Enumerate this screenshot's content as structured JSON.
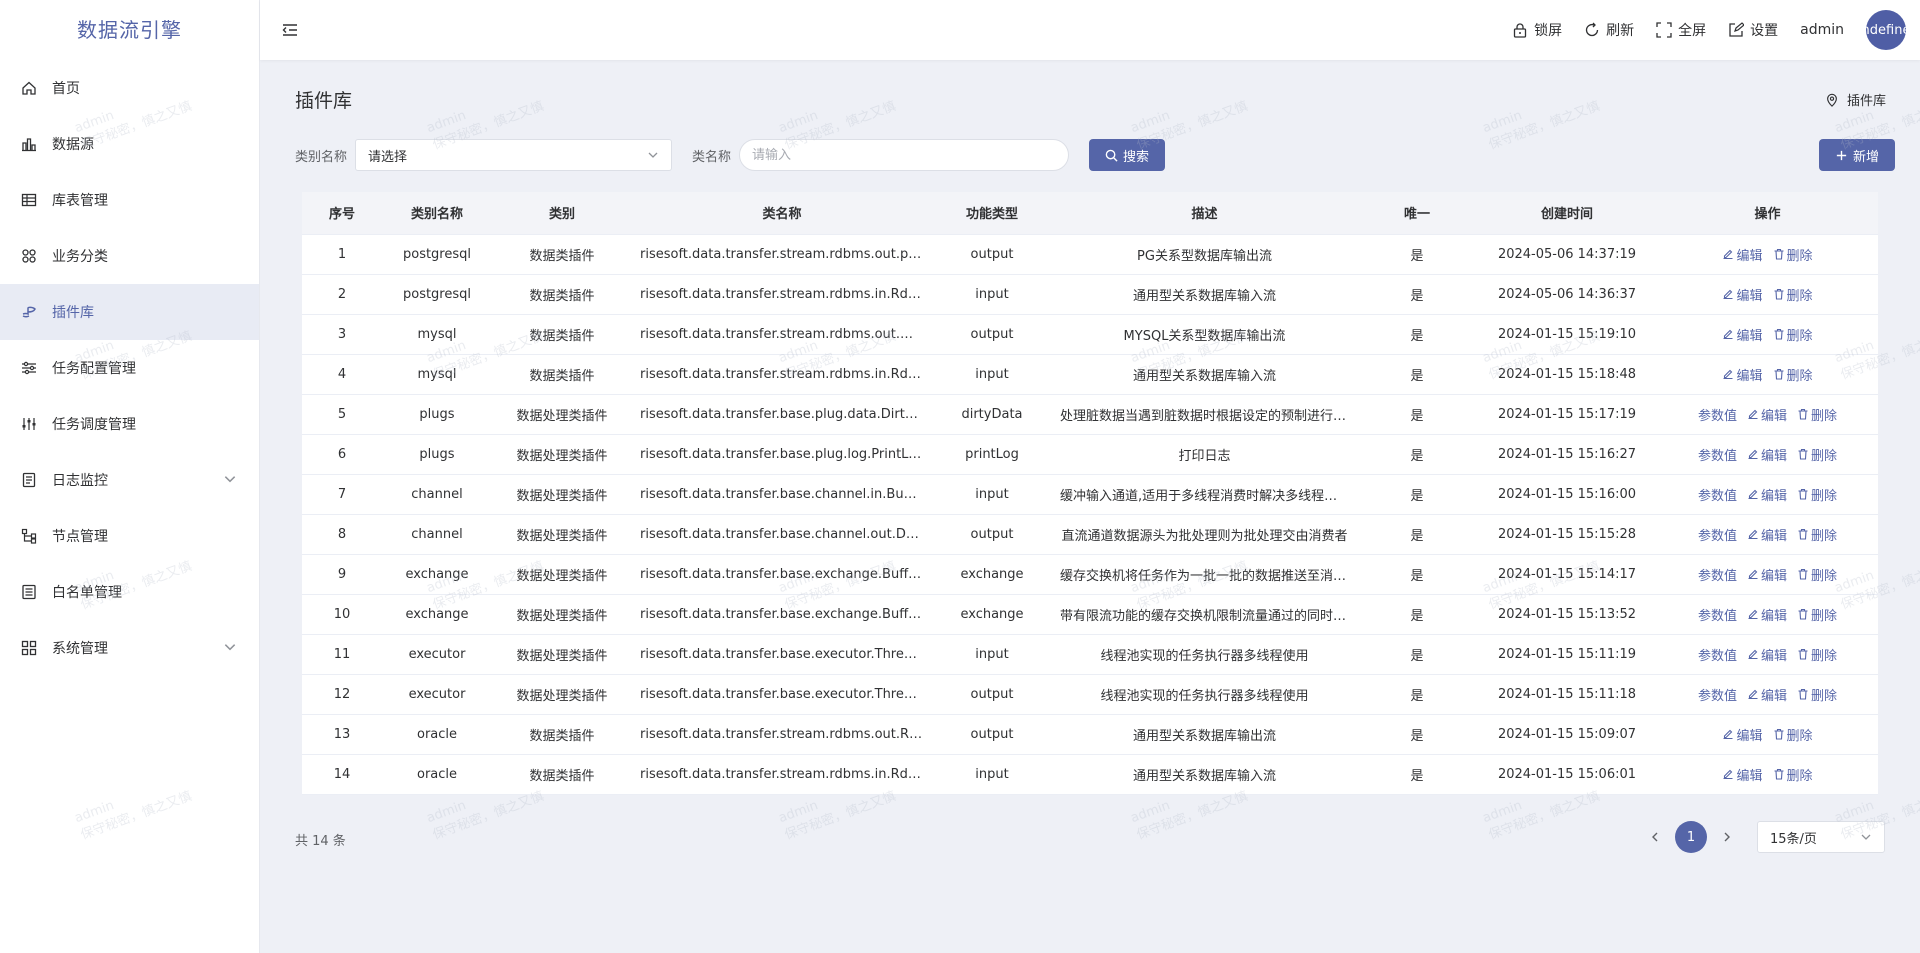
{
  "app": {
    "title": "数据流引擎"
  },
  "sidebar": {
    "items": [
      {
        "label": "首页",
        "icon": "home-icon"
      },
      {
        "label": "数据源",
        "icon": "datasource-icon"
      },
      {
        "label": "库表管理",
        "icon": "table-icon"
      },
      {
        "label": "业务分类",
        "icon": "category-icon"
      },
      {
        "label": "插件库",
        "icon": "plugin-icon",
        "active": true
      },
      {
        "label": "任务配置管理",
        "icon": "sliders-icon"
      },
      {
        "label": "任务调度管理",
        "icon": "schedule-icon"
      },
      {
        "label": "日志监控",
        "icon": "log-icon",
        "expandable": true
      },
      {
        "label": "节点管理",
        "icon": "node-icon"
      },
      {
        "label": "白名单管理",
        "icon": "whitelist-icon"
      },
      {
        "label": "系统管理",
        "icon": "system-icon",
        "expandable": true
      }
    ]
  },
  "header": {
    "lock": "锁屏",
    "refresh": "刷新",
    "fullscreen": "全屏",
    "settings": "设置",
    "username": "admin",
    "avatar_text": "undefined"
  },
  "page": {
    "title": "插件库",
    "breadcrumb": "插件库"
  },
  "filter": {
    "category_label": "类别名称",
    "category_value": "请选择",
    "classname_label": "类名称",
    "classname_placeholder": "请输入",
    "search_label": "搜索",
    "add_label": "新增"
  },
  "table": {
    "columns": [
      "序号",
      "类别名称",
      "类别",
      "类名称",
      "功能类型",
      "描述",
      "唯一",
      "创建时间",
      "操作"
    ],
    "rows": [
      {
        "no": "1",
        "cat_name": "postgresql",
        "cat": "数据类插件",
        "class": "risesoft.data.transfer.stream.rdbms.out.pg.PGOutputStreamFactory",
        "func": "output",
        "desc": "PG关系型数据库输出流",
        "unique": "是",
        "time": "2024-05-06 14:37:19",
        "param": false
      },
      {
        "no": "2",
        "cat_name": "postgresql",
        "cat": "数据类插件",
        "class": "risesoft.data.transfer.stream.rdbms.in.RdbmsInputStreamFactory",
        "func": "input",
        "desc": "通用型关系数据库输入流",
        "unique": "是",
        "time": "2024-05-06 14:36:37",
        "param": false
      },
      {
        "no": "3",
        "cat_name": "mysql",
        "cat": "数据类插件",
        "class": "risesoft.data.transfer.stream.rdbms.out.mysql.MysqlOutputStreamFactory",
        "func": "output",
        "desc": "MYSQL关系型数据库输出流",
        "unique": "是",
        "time": "2024-01-15 15:19:10",
        "param": false
      },
      {
        "no": "4",
        "cat_name": "mysql",
        "cat": "数据类插件",
        "class": "risesoft.data.transfer.stream.rdbms.in.RdbmsInputStreamFactory",
        "func": "input",
        "desc": "通用型关系数据库输入流",
        "unique": "是",
        "time": "2024-01-15 15:18:48",
        "param": false
      },
      {
        "no": "5",
        "cat_name": "plugs",
        "cat": "数据处理类插件",
        "class": "risesoft.data.transfer.base.plug.data.DirtyDataPlug",
        "func": "dirtyData",
        "desc": "处理脏数据当遇到脏数据时根据设定的预制进行处理",
        "unique": "是",
        "time": "2024-01-15 15:17:19",
        "param": true
      },
      {
        "no": "6",
        "cat_name": "plugs",
        "cat": "数据处理类插件",
        "class": "risesoft.data.transfer.base.plug.log.PrintLogPlug",
        "func": "printLog",
        "desc": "打印日志",
        "unique": "是",
        "time": "2024-01-15 15:16:27",
        "param": true
      },
      {
        "no": "7",
        "cat_name": "channel",
        "cat": "数据处理类插件",
        "class": "risesoft.data.transfer.base.channel.in.BufferRecordInputChannel",
        "func": "input",
        "desc": "缓冲输入通道,适用于多线程消费时解决多线程竞争",
        "unique": "是",
        "time": "2024-01-15 15:16:00",
        "param": true
      },
      {
        "no": "8",
        "cat_name": "channel",
        "cat": "数据处理类插件",
        "class": "risesoft.data.transfer.base.channel.out.DCOutputChannel",
        "func": "output",
        "desc": "直流通道数据源头为批处理则为批处理交由消费者",
        "unique": "是",
        "time": "2024-01-15 15:15:28",
        "param": true
      },
      {
        "no": "9",
        "cat_name": "exchange",
        "cat": "数据处理类插件",
        "class": "risesoft.data.transfer.base.exchange.BufferRecordExchange",
        "func": "exchange",
        "desc": "缓存交换机将任务作为一批一批的数据推送至消费者",
        "unique": "是",
        "time": "2024-01-15 15:14:17",
        "param": true
      },
      {
        "no": "10",
        "cat_name": "exchange",
        "cat": "数据处理类插件",
        "class": "risesoft.data.transfer.base.exchange.BufferRecordLimitExchange",
        "func": "exchange",
        "desc": "带有限流功能的缓存交换机限制流量通过的同时缓存数据",
        "unique": "是",
        "time": "2024-01-15 15:13:52",
        "param": true
      },
      {
        "no": "11",
        "cat_name": "executor",
        "cat": "数据处理类插件",
        "class": "risesoft.data.transfer.base.executor.ThreadPoolExecutor",
        "func": "input",
        "desc": "线程池实现的任务执行器多线程使用",
        "unique": "是",
        "time": "2024-01-15 15:11:19",
        "param": true
      },
      {
        "no": "12",
        "cat_name": "executor",
        "cat": "数据处理类插件",
        "class": "risesoft.data.transfer.base.executor.ThreadPoolExecutor",
        "func": "output",
        "desc": "线程池实现的任务执行器多线程使用",
        "unique": "是",
        "time": "2024-01-15 15:11:18",
        "param": true
      },
      {
        "no": "13",
        "cat_name": "oracle",
        "cat": "数据类插件",
        "class": "risesoft.data.transfer.stream.rdbms.out.RdbmsOutputStreamFactory",
        "func": "output",
        "desc": "通用型关系数据库输出流",
        "unique": "是",
        "time": "2024-01-15 15:09:07",
        "param": false
      },
      {
        "no": "14",
        "cat_name": "oracle",
        "cat": "数据类插件",
        "class": "risesoft.data.transfer.stream.rdbms.in.RdbmsInputStreamFactory",
        "func": "input",
        "desc": "通用型关系数据库输入流",
        "unique": "是",
        "time": "2024-01-15 15:06:01",
        "param": false
      }
    ],
    "ops": {
      "param": "参数值",
      "edit": "编辑",
      "delete": "删除"
    }
  },
  "footer": {
    "total": "共 14 条",
    "current_page": "1",
    "page_size": "15条/页"
  },
  "watermark": {
    "line1": "admin",
    "line2": "保守秘密，慎之又慎"
  },
  "colors": {
    "primary": "#5565a8",
    "active_bg": "#e8ebf4",
    "page_bg": "#eef0f6"
  }
}
